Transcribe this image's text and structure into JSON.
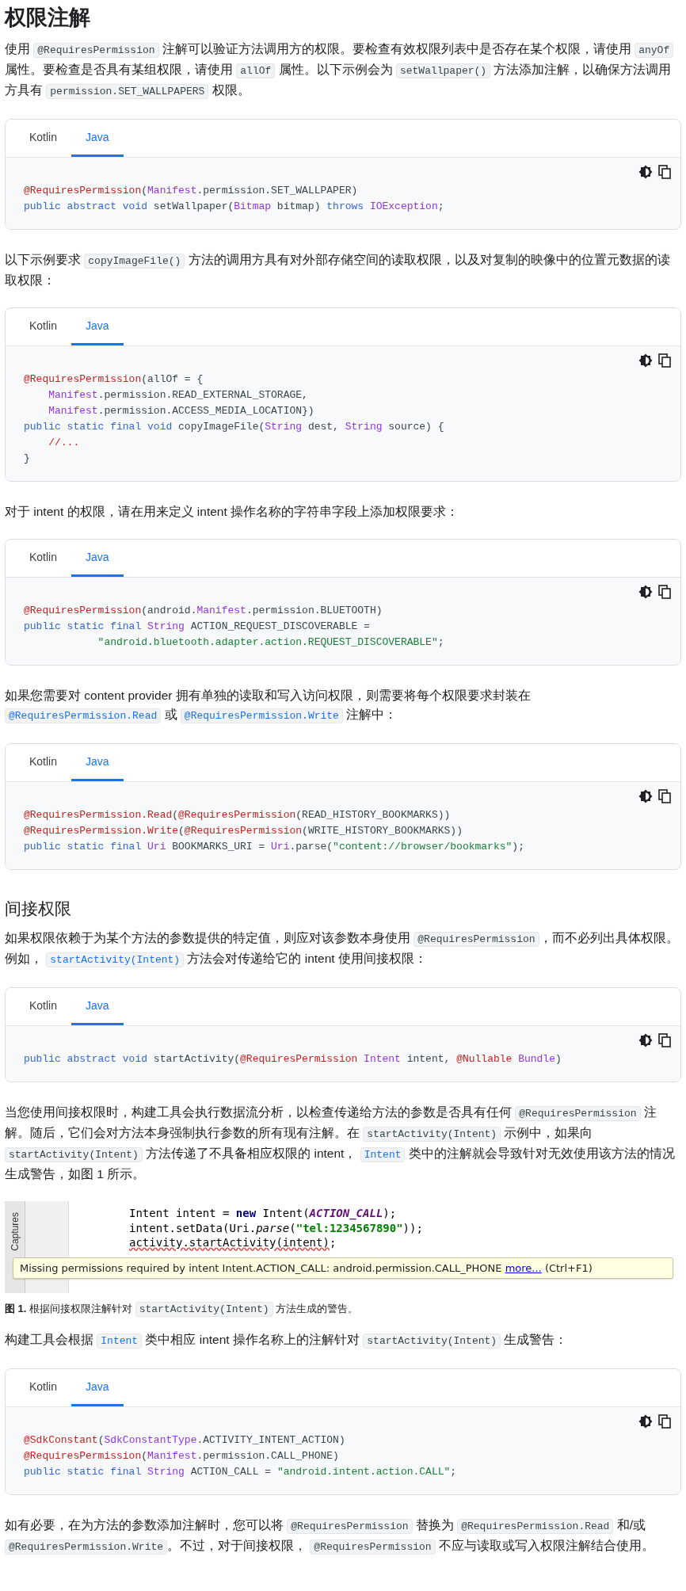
{
  "content": [
    {
      "kind": "heading1",
      "text": "权限注解"
    },
    {
      "kind": "paragraph",
      "segments": [
        {
          "kind": "text",
          "text": "使用 "
        },
        {
          "kind": "code",
          "text": "@RequiresPermission"
        },
        {
          "kind": "text",
          "text": " 注解可以验证方法调用方的权限。要检查有效权限列表中是否存在某个权限，请使用 "
        },
        {
          "kind": "code",
          "text": "anyOf"
        },
        {
          "kind": "text",
          "text": " 属性。要检查是否具有某组权限，请使用 "
        },
        {
          "kind": "code",
          "text": "allOf"
        },
        {
          "kind": "text",
          "text": " 属性。以下示例会为 "
        },
        {
          "kind": "code",
          "text": "setWallpaper()"
        },
        {
          "kind": "text",
          "text": " 方法添加注解，以确保方法调用方具有 "
        },
        {
          "kind": "code",
          "text": "permission.SET_WALLPAPERS"
        },
        {
          "kind": "text",
          "text": " 权限。"
        }
      ]
    },
    {
      "kind": "code_sample",
      "tabs": [
        {
          "label": "Kotlin",
          "selected": false
        },
        {
          "label": "Java",
          "selected": true
        }
      ],
      "lines": [
        [
          {
            "kind": "annotation",
            "text": "@RequiresPermission"
          },
          {
            "kind": "plain",
            "text": "("
          },
          {
            "kind": "type",
            "text": "Manifest"
          },
          {
            "kind": "plain",
            "text": ".permission.SET_WALLPAPER)"
          }
        ],
        [
          {
            "kind": "keyword",
            "text": "public abstract void"
          },
          {
            "kind": "plain",
            "text": " setWallpaper("
          },
          {
            "kind": "type",
            "text": "Bitmap"
          },
          {
            "kind": "plain",
            "text": " bitmap) "
          },
          {
            "kind": "keyword",
            "text": "throws "
          },
          {
            "kind": "type",
            "text": "IOException"
          },
          {
            "kind": "plain",
            "text": ";"
          }
        ]
      ]
    },
    {
      "kind": "paragraph",
      "segments": [
        {
          "kind": "text",
          "text": "以下示例要求 "
        },
        {
          "kind": "code",
          "text": "copyImageFile()"
        },
        {
          "kind": "text",
          "text": " 方法的调用方具有对外部存储空间的读取权限，以及对复制的映像中的位置元数据的读取权限："
        }
      ]
    },
    {
      "kind": "code_sample",
      "tabs": [
        {
          "label": "Kotlin",
          "selected": false
        },
        {
          "label": "Java",
          "selected": true
        }
      ],
      "lines": [
        [
          {
            "kind": "annotation",
            "text": "@RequiresPermission"
          },
          {
            "kind": "plain",
            "text": "(allOf = {"
          }
        ],
        [
          {
            "kind": "type",
            "text": "    Manifest"
          },
          {
            "kind": "plain",
            "text": ".permission.READ_EXTERNAL_STORAGE,"
          }
        ],
        [
          {
            "kind": "type",
            "text": "    Manifest"
          },
          {
            "kind": "plain",
            "text": ".permission.ACCESS_MEDIA_LOCATION})"
          }
        ],
        [
          {
            "kind": "keyword",
            "text": "public static final void"
          },
          {
            "kind": "plain",
            "text": " copyImageFile("
          },
          {
            "kind": "type",
            "text": "String"
          },
          {
            "kind": "plain",
            "text": " dest, "
          },
          {
            "kind": "type",
            "text": "String"
          },
          {
            "kind": "plain",
            "text": " source) {"
          }
        ],
        [
          {
            "kind": "comment",
            "text": "    //..."
          }
        ],
        [
          {
            "kind": "plain",
            "text": "}"
          }
        ]
      ]
    },
    {
      "kind": "paragraph",
      "segments": [
        {
          "kind": "text",
          "text": "对于 intent 的权限，请在用来定义 intent 操作名称的字符串字段上添加权限要求："
        }
      ]
    },
    {
      "kind": "code_sample",
      "tabs": [
        {
          "label": "Kotlin",
          "selected": false
        },
        {
          "label": "Java",
          "selected": true
        }
      ],
      "lines": [
        [
          {
            "kind": "annotation",
            "text": "@RequiresPermission"
          },
          {
            "kind": "plain",
            "text": "(android."
          },
          {
            "kind": "type",
            "text": "Manifest"
          },
          {
            "kind": "plain",
            "text": ".permission.BLUETOOTH)"
          }
        ],
        [
          {
            "kind": "keyword",
            "text": "public static final "
          },
          {
            "kind": "type",
            "text": "String"
          },
          {
            "kind": "plain",
            "text": " ACTION_REQUEST_DISCOVERABLE ="
          }
        ],
        [
          {
            "kind": "string",
            "text": "            \"android.bluetooth.adapter.action.REQUEST_DISCOVERABLE\""
          },
          {
            "kind": "plain",
            "text": ";"
          }
        ]
      ]
    },
    {
      "kind": "paragraph",
      "segments": [
        {
          "kind": "text",
          "text": "如果您需要对 content provider 拥有单独的读取和写入访问权限，则需要将每个权限要求封装在 "
        },
        {
          "kind": "code_link",
          "text": "@RequiresPermission.Read"
        },
        {
          "kind": "text",
          "text": " 或 "
        },
        {
          "kind": "code_link",
          "text": "@RequiresPermission.Write"
        },
        {
          "kind": "text",
          "text": " 注解中："
        }
      ]
    },
    {
      "kind": "code_sample",
      "tabs": [
        {
          "label": "Kotlin",
          "selected": false
        },
        {
          "label": "Java",
          "selected": true
        }
      ],
      "lines": [
        [
          {
            "kind": "annotation",
            "text": "@RequiresPermission.Read"
          },
          {
            "kind": "plain",
            "text": "("
          },
          {
            "kind": "annotation",
            "text": "@RequiresPermission"
          },
          {
            "kind": "plain",
            "text": "(READ_HISTORY_BOOKMARKS))"
          }
        ],
        [
          {
            "kind": "annotation",
            "text": "@RequiresPermission.Write"
          },
          {
            "kind": "plain",
            "text": "("
          },
          {
            "kind": "annotation",
            "text": "@RequiresPermission"
          },
          {
            "kind": "plain",
            "text": "(WRITE_HISTORY_BOOKMARKS))"
          }
        ],
        [
          {
            "kind": "keyword",
            "text": "public static final "
          },
          {
            "kind": "type",
            "text": "Uri"
          },
          {
            "kind": "plain",
            "text": " BOOKMARKS_URI = "
          },
          {
            "kind": "type",
            "text": "Uri"
          },
          {
            "kind": "plain",
            "text": ".parse("
          },
          {
            "kind": "string",
            "text": "\"content://browser/bookmarks\""
          },
          {
            "kind": "plain",
            "text": ");"
          }
        ]
      ]
    },
    {
      "kind": "heading2",
      "text": "间接权限"
    },
    {
      "kind": "paragraph",
      "segments": [
        {
          "kind": "text",
          "text": "如果权限依赖于为某个方法的参数提供的特定值，则应对该参数本身使用 "
        },
        {
          "kind": "code",
          "text": "@RequiresPermission"
        },
        {
          "kind": "text",
          "text": "，而不必列出具体权限。例如， "
        },
        {
          "kind": "code_link",
          "text": "startActivity(Intent)"
        },
        {
          "kind": "text",
          "text": " 方法会对传递给它的 intent 使用间接权限："
        }
      ]
    },
    {
      "kind": "code_sample",
      "tabs": [
        {
          "label": "Kotlin",
          "selected": false
        },
        {
          "label": "Java",
          "selected": true
        }
      ],
      "lines": [
        [
          {
            "kind": "keyword",
            "text": "public abstract void"
          },
          {
            "kind": "plain",
            "text": " startActivity("
          },
          {
            "kind": "annotation",
            "text": "@RequiresPermission "
          },
          {
            "kind": "type",
            "text": "Intent"
          },
          {
            "kind": "plain",
            "text": " intent, "
          },
          {
            "kind": "annotation",
            "text": "@Nullable "
          },
          {
            "kind": "type",
            "text": "Bundle"
          },
          {
            "kind": "plain",
            "text": ")"
          }
        ]
      ]
    },
    {
      "kind": "paragraph",
      "segments": [
        {
          "kind": "text",
          "text": "当您使用间接权限时，构建工具会执行数据流分析，以检查传递给方法的参数是否具有任何 "
        },
        {
          "kind": "code",
          "text": "@RequiresPermission"
        },
        {
          "kind": "text",
          "text": " 注解。随后，它们会对方法本身强制执行参数的所有现有注解。在 "
        },
        {
          "kind": "code",
          "text": "startActivity(Intent)"
        },
        {
          "kind": "text",
          "text": " 示例中，如果向 "
        },
        {
          "kind": "code",
          "text": "startActivity(Intent)"
        },
        {
          "kind": "text",
          "text": " 方法传递了不具备相应权限的 intent， "
        },
        {
          "kind": "code_link",
          "text": "Intent"
        },
        {
          "kind": "text",
          "text": " 类中的注解就会导致针对无效使用该方法的情况生成警告，如图 1 所示。"
        }
      ]
    },
    {
      "kind": "figure",
      "side_tab": "Captures",
      "lines": [
        [
          {
            "kind": "plain",
            "text": "Intent intent = "
          },
          {
            "kind": "keyword",
            "text": "new"
          },
          {
            "kind": "plain",
            "text": " Intent("
          },
          {
            "kind": "constant",
            "text": "ACTION_CALL"
          },
          {
            "kind": "plain",
            "text": ");"
          }
        ],
        [
          {
            "kind": "plain",
            "text": "intent.setData(Uri."
          },
          {
            "kind": "static_method",
            "text": "parse"
          },
          {
            "kind": "plain",
            "text": "("
          },
          {
            "kind": "string",
            "text": "\"tel:1234567890\""
          },
          {
            "kind": "plain",
            "text": "));"
          }
        ],
        [
          {
            "kind": "error",
            "text": "activity.startActivity(intent)"
          },
          {
            "kind": "plain",
            "text": ";"
          }
        ]
      ],
      "tooltip": {
        "message": "Missing permissions required by intent Intent.ACTION_CALL: android.permission.CALL_PHONE",
        "link": "more...",
        "shortcut": "(Ctrl+F1)"
      }
    },
    {
      "kind": "caption",
      "segments": [
        {
          "kind": "bold",
          "text": "图 1."
        },
        {
          "kind": "text",
          "text": " 根据间接权限注解针对 "
        },
        {
          "kind": "code",
          "text": "startActivity(Intent)"
        },
        {
          "kind": "text",
          "text": " 方法生成的警告。"
        }
      ]
    },
    {
      "kind": "paragraph",
      "segments": [
        {
          "kind": "text",
          "text": "构建工具会根据 "
        },
        {
          "kind": "code_link",
          "text": "Intent"
        },
        {
          "kind": "text",
          "text": " 类中相应 intent 操作名称上的注解针对 "
        },
        {
          "kind": "code",
          "text": "startActivity(Intent)"
        },
        {
          "kind": "text",
          "text": " 生成警告："
        }
      ]
    },
    {
      "kind": "code_sample",
      "tabs": [
        {
          "label": "Kotlin",
          "selected": false
        },
        {
          "label": "Java",
          "selected": true
        }
      ],
      "lines": [
        [
          {
            "kind": "annotation",
            "text": "@SdkConstant"
          },
          {
            "kind": "plain",
            "text": "("
          },
          {
            "kind": "type",
            "text": "SdkConstantType"
          },
          {
            "kind": "plain",
            "text": ".ACTIVITY_INTENT_ACTION)"
          }
        ],
        [
          {
            "kind": "annotation",
            "text": "@RequiresPermission"
          },
          {
            "kind": "plain",
            "text": "("
          },
          {
            "kind": "type",
            "text": "Manifest"
          },
          {
            "kind": "plain",
            "text": ".permission.CALL_PHONE)"
          }
        ],
        [
          {
            "kind": "keyword",
            "text": "public static final "
          },
          {
            "kind": "type",
            "text": "String"
          },
          {
            "kind": "plain",
            "text": " ACTION_CALL = "
          },
          {
            "kind": "string",
            "text": "\"android.intent.action.CALL\""
          },
          {
            "kind": "plain",
            "text": ";"
          }
        ]
      ]
    },
    {
      "kind": "paragraph",
      "segments": [
        {
          "kind": "text",
          "text": "如有必要，在为方法的参数添加注解时，您可以将 "
        },
        {
          "kind": "code",
          "text": "@RequiresPermission"
        },
        {
          "kind": "text",
          "text": " 替换为 "
        },
        {
          "kind": "code",
          "text": "@RequiresPermission.Read"
        },
        {
          "kind": "text",
          "text": " 和/或 "
        },
        {
          "kind": "code",
          "text": "@RequiresPermission.Write"
        },
        {
          "kind": "text",
          "text": "。不过，对于间接权限， "
        },
        {
          "kind": "code",
          "text": "@RequiresPermission"
        },
        {
          "kind": "text",
          "text": " 不应与读取或写入权限注解结合使用。"
        }
      ]
    }
  ]
}
